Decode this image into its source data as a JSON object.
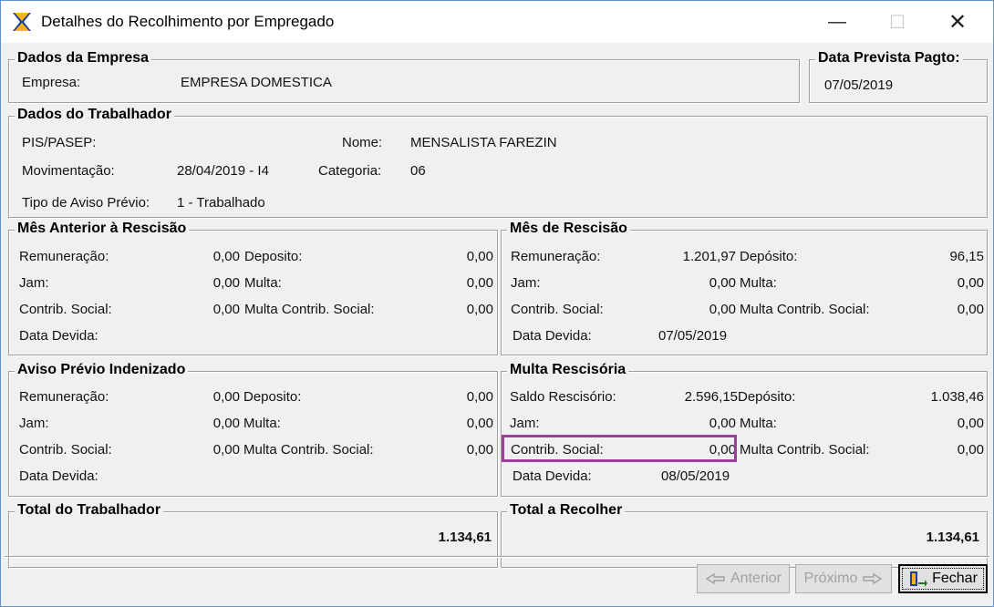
{
  "window": {
    "title": "Detalhes do Recolhimento por Empregado",
    "minimize": "—",
    "maximize": "☐",
    "close": "✕"
  },
  "empresa": {
    "legend": "Dados da Empresa",
    "empresa_label": "Empresa:",
    "empresa_value": "EMPRESA DOMESTICA"
  },
  "pagto": {
    "legend": "Data Prevista Pagto:",
    "value": "07/05/2019"
  },
  "trabalhador": {
    "legend": "Dados do Trabalhador",
    "pis_label": "PIS/PASEP:",
    "pis_value": "",
    "nome_label": "Nome:",
    "nome_value": "MENSALISTA FAREZIN",
    "mov_label": "Movimentação:",
    "mov_value": "28/04/2019 - I4",
    "cat_label": "Categoria:",
    "cat_value": "06",
    "aviso_label": "Tipo de Aviso Prévio:",
    "aviso_value": "1 - Trabalhado"
  },
  "mes_anterior": {
    "legend": "Mês Anterior à Rescisão",
    "remuneracao_label": "Remuneração:",
    "remuneracao_value": "0,00",
    "jam_label": "Jam:",
    "jam_value": "0,00",
    "contrib_label": "Contrib. Social:",
    "contrib_value": "0,00",
    "data_label": "Data Devida:",
    "data_value": "",
    "deposito_label": "Deposito:",
    "deposito_value": "0,00",
    "multa_label": "Multa:",
    "multa_value": "0,00",
    "multa_contrib_label": "Multa Contrib. Social:",
    "multa_contrib_value": "0,00"
  },
  "mes_rescisao": {
    "legend": "Mês de Rescisão",
    "remuneracao_label": "Remuneração:",
    "remuneracao_value": "1.201,97",
    "jam_label": "Jam:",
    "jam_value": "0,00",
    "contrib_label": "Contrib. Social:",
    "contrib_value": "0,00",
    "data_label": "Data Devida:",
    "data_value": "07/05/2019",
    "deposito_label": "Depósito:",
    "deposito_value": "96,15",
    "multa_label": "Multa:",
    "multa_value": "0,00",
    "multa_contrib_label": "Multa Contrib. Social:",
    "multa_contrib_value": "0,00"
  },
  "aviso_indenizado": {
    "legend": "Aviso Prévio Indenizado",
    "remuneracao_label": "Remuneração:",
    "remuneracao_value": "0,00",
    "jam_label": "Jam:",
    "jam_value": "0,00",
    "contrib_label": "Contrib. Social:",
    "contrib_value": "0,00",
    "data_label": "Data Devida:",
    "data_value": "",
    "deposito_label": "Deposito:",
    "deposito_value": "0,00",
    "multa_label": "Multa:",
    "multa_value": "0,00",
    "multa_contrib_label": "Multa Contrib. Social:",
    "multa_contrib_value": "0,00"
  },
  "multa_rescisoria": {
    "legend": "Multa Rescisória",
    "saldo_label": "Saldo Rescisório:",
    "saldo_value": "2.596,15",
    "jam_label": "Jam:",
    "jam_value": "0,00",
    "contrib_label": "Contrib. Social:",
    "contrib_value": "0,00",
    "data_label": "Data Devida:",
    "data_value": "08/05/2019",
    "deposito_label": "Depósito:",
    "deposito_value": "1.038,46",
    "multa_label": "Multa:",
    "multa_value": "0,00",
    "multa_contrib_label": "Multa Contrib. Social:",
    "multa_contrib_value": "0,00"
  },
  "total_trabalhador": {
    "legend": "Total do Trabalhador",
    "value": "1.134,61"
  },
  "total_recolher": {
    "legend": "Total a Recolher",
    "value": "1.134,61"
  },
  "buttons": {
    "anterior": "Anterior",
    "proximo": "Próximo",
    "fechar": "Fechar"
  },
  "colors": {
    "highlight": "#9b3f98",
    "window_border": "#5f8fd6"
  }
}
